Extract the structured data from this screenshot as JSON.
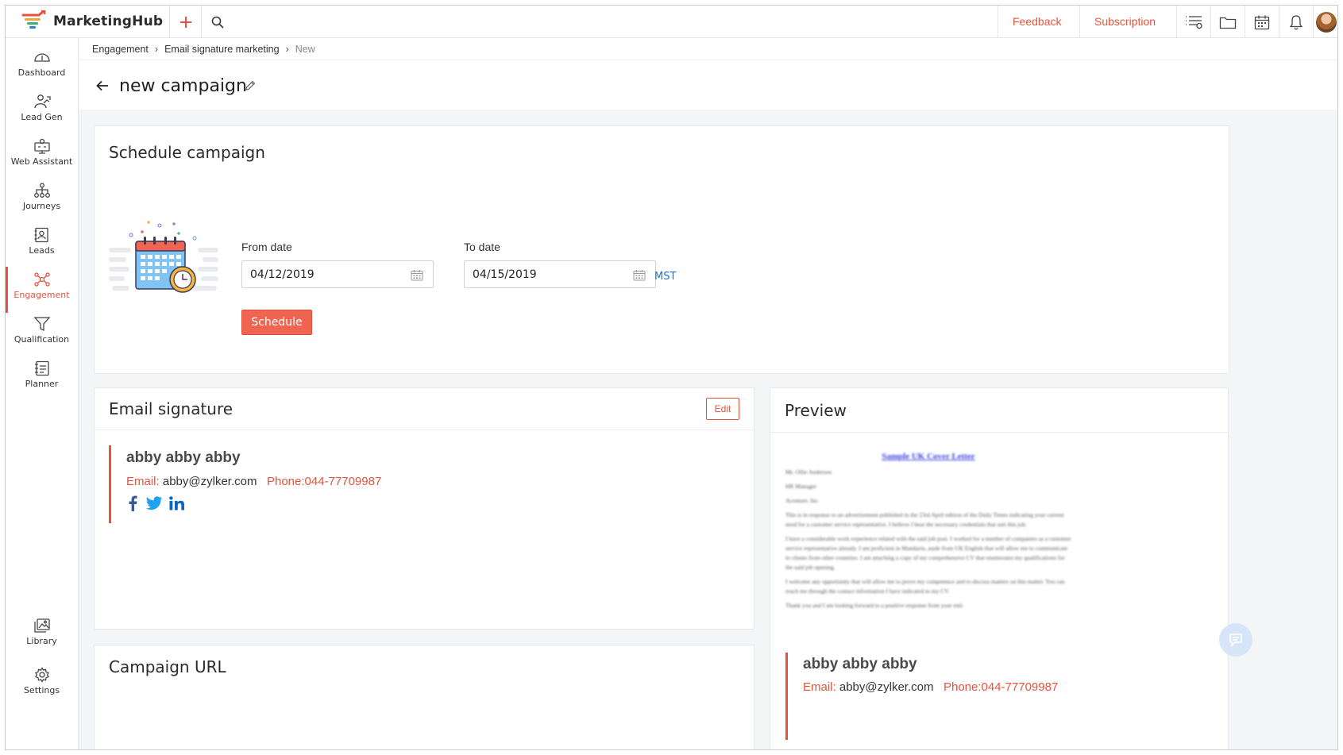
{
  "app": {
    "brand": "MarketingHub"
  },
  "topbar": {
    "feedback": "Feedback",
    "subscription": "Subscription",
    "icons": [
      "plus-icon",
      "search-icon",
      "tasks-list-icon",
      "folder-icon",
      "calendar-icon",
      "bell-icon",
      "user-avatar"
    ]
  },
  "sidebar": {
    "items": [
      {
        "label": "Dashboard",
        "icon": "dashboard-icon"
      },
      {
        "label": "Lead Gen",
        "icon": "lead-gen-icon"
      },
      {
        "label": "Web Assistant",
        "icon": "web-assistant-icon"
      },
      {
        "label": "Journeys",
        "icon": "journeys-icon"
      },
      {
        "label": "Leads",
        "icon": "leads-icon"
      },
      {
        "label": "Engagement",
        "icon": "engagement-icon",
        "active": true
      },
      {
        "label": "Qualification",
        "icon": "funnel-icon"
      },
      {
        "label": "Planner",
        "icon": "planner-icon"
      }
    ],
    "bottom": [
      {
        "label": "Library",
        "icon": "library-icon"
      },
      {
        "label": "Settings",
        "icon": "settings-icon"
      }
    ]
  },
  "breadcrumb": {
    "items": [
      "Engagement",
      "Email signature marketing"
    ],
    "current": "New"
  },
  "page": {
    "title": "new campaign"
  },
  "schedule": {
    "title": "Schedule campaign",
    "from_label": "From date",
    "from_value": "04/12/2019",
    "to_label": "To date",
    "to_value": "04/15/2019",
    "timezone": "MST",
    "button": "Schedule"
  },
  "signature": {
    "title": "Email signature",
    "edit": "Edit",
    "name": "abby abby abby",
    "email_label": "Email:",
    "email": "abby@zylker.com",
    "phone": "Phone:044-77709987",
    "social": [
      "facebook-icon",
      "twitter-icon",
      "linkedin-icon"
    ]
  },
  "campaign_url": {
    "title": "Campaign URL"
  },
  "preview": {
    "title": "Preview",
    "letter_title": "Sample UK Cover Letter",
    "letter_lines": [
      "Mr. Ollie Anderson",
      "HR Manager",
      "Acenture, Inc.",
      "This is in response to an advertisement published in the 23rd April edition of the Daily Times indicating your current need for a customer service representative. I believe I bear the necessary credentials that suit this job.",
      "I have a considerable work experience related with the said job post. I worked for a number of companies as a customer service representative already. I am proficient in Mandarin, aside from UK English that will allow me to communicate to clients from other countries. I am attaching a copy of my comprehensive CV that enumerates my qualifications for the said job opening.",
      "I welcome any opportunity that will allow me to prove my competence and to discuss matters on this matter. You can reach me through the contact information I have indicated in my CV.",
      "Thank you and I am looking forward to a positive response from your end."
    ],
    "sig_name": "abby abby abby",
    "sig_email_label": "Email:",
    "sig_email": "abby@zylker.com",
    "sig_phone": "Phone:044-77709987"
  }
}
